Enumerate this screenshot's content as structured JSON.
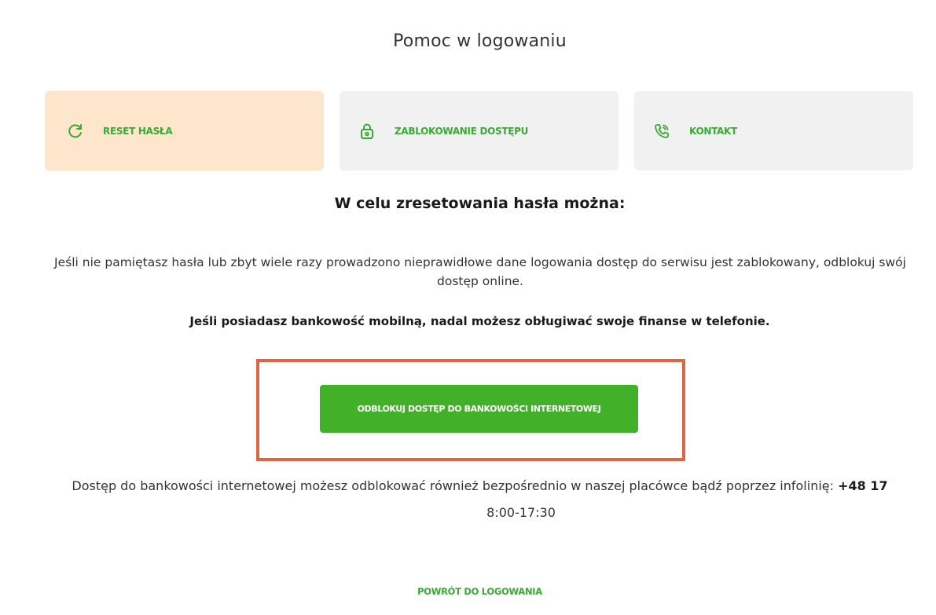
{
  "page": {
    "title": "Pomoc w logowaniu"
  },
  "tabs": [
    {
      "label": "RESET HASŁA",
      "icon": "refresh-icon",
      "active": true
    },
    {
      "label": "ZABLOKOWANIE DOSTĘPU",
      "icon": "lock-icon",
      "active": false
    },
    {
      "label": "KONTAKT",
      "icon": "phone-icon",
      "active": false
    }
  ],
  "content": {
    "heading": "W celu zresetowania hasła można:",
    "paragraph": "Jeśli nie pamiętasz hasła lub zbyt wiele razy prowadzono nieprawidłowe dane logowania dostęp do serwisu jest zablokowany, odblokuj swój dostęp online.",
    "note": "Jeśli posiadasz bankowość mobilną, nadal możesz obługiwać swoje finanse w telefonie.",
    "unlock_button": "ODBLOKUJ DOSTĘP DO BANKOWOŚCI INTERNETOWEJ",
    "info_text": "Dostęp do bankowości internetowej możesz odblokować również bezpośrednio w naszej placówce bądź poprzez infolinię:",
    "phone_prefix": "+48 17",
    "hours": "8:00-17:30",
    "back_link": "POWRÓT DO LOGOWANIA"
  },
  "colors": {
    "accent_green": "#43b02a",
    "active_tab_bg": "#fde6cb",
    "inactive_tab_bg": "#f1f1f1",
    "highlight_border": "#e06440"
  }
}
